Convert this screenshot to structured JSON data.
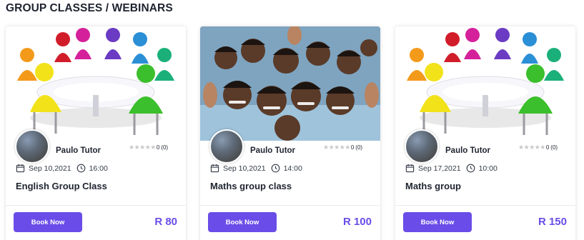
{
  "section_title": "GROUP CLASSES / WEBINARS",
  "accent_color": "#6a4de8",
  "cards": [
    {
      "image": "meeting-round-table-figures",
      "tutor": "Paulo Tutor",
      "rating_score": "0",
      "rating_count": "(0)",
      "date": "Sep 10,2021",
      "time": "16:00",
      "title": "English Group Class",
      "button": "Book Now",
      "price": "R 80"
    },
    {
      "image": "students-group-photo",
      "tutor": "Paulo Tutor",
      "rating_score": "0",
      "rating_count": "(0)",
      "date": "Sep 10,2021",
      "time": "14:00",
      "title": "Maths group class",
      "button": "Book Now",
      "price": "R 100"
    },
    {
      "image": "meeting-round-table-figures",
      "tutor": "Paulo Tutor",
      "rating_score": "0",
      "rating_count": "(0)",
      "date": "Sep 17,2021",
      "time": "10:00",
      "title": "Maths group",
      "button": "Book Now",
      "price": "R 150"
    }
  ]
}
